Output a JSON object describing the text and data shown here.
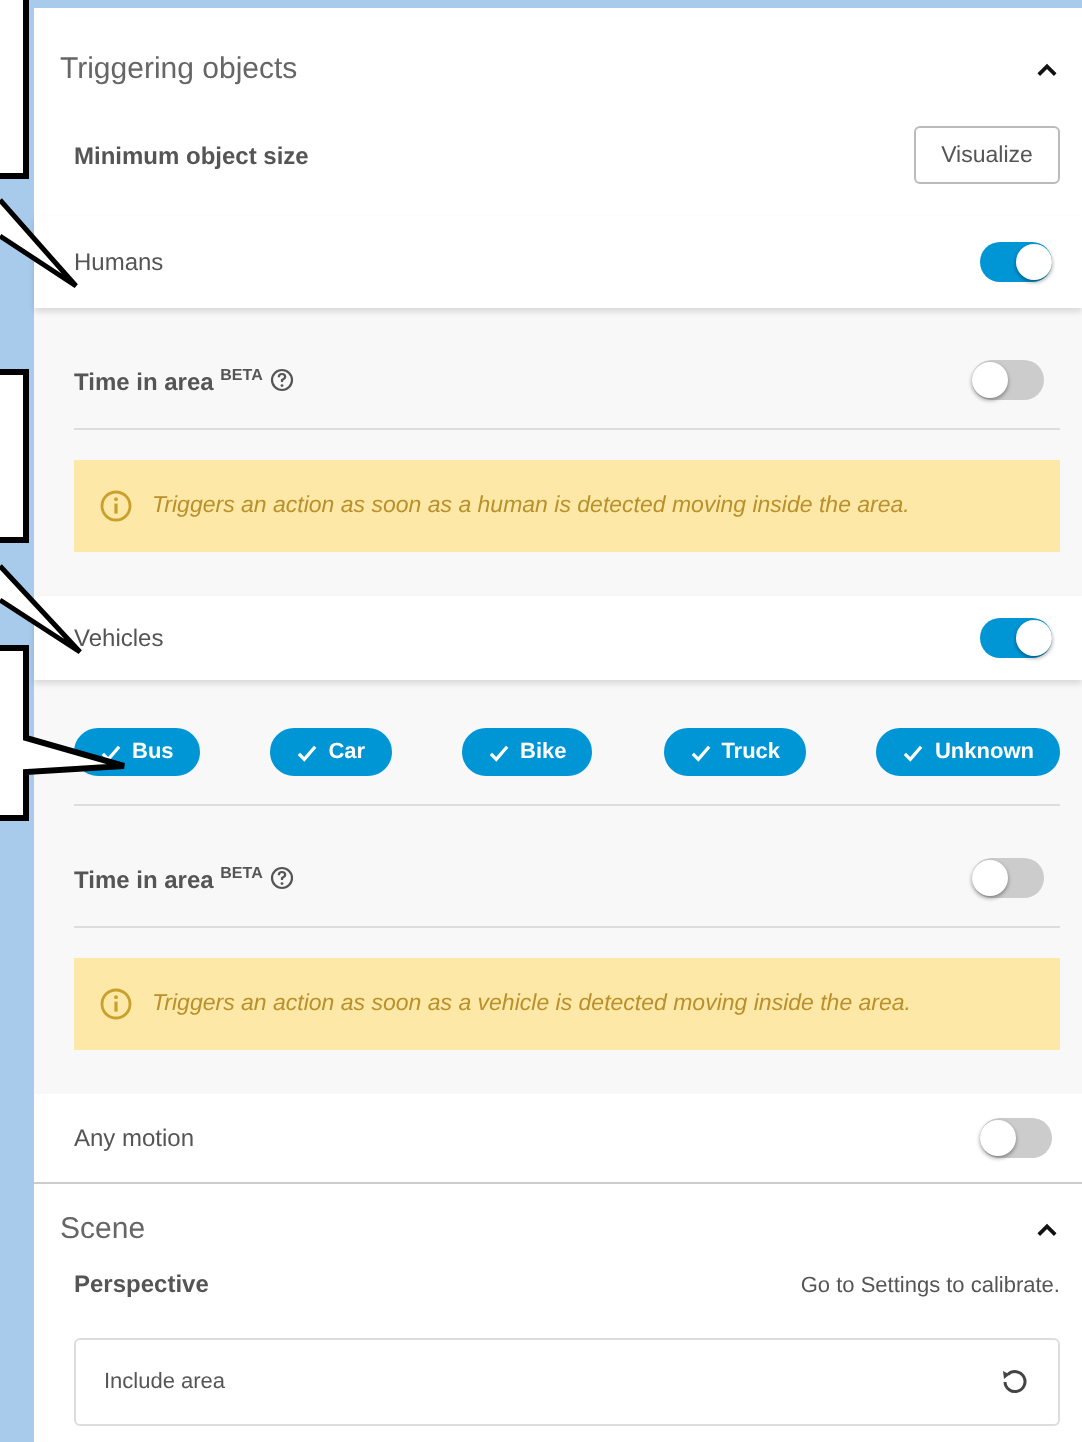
{
  "triggering": {
    "title": "Triggering objects",
    "expanded": true,
    "min_size": {
      "label": "Minimum object size",
      "button": "Visualize"
    },
    "objects": [
      {
        "label": "Humans",
        "on": true,
        "time_in_area": {
          "label": "Time in area",
          "badge": "BETA",
          "on": false
        },
        "notice": "Triggers an action as soon as a human is detected moving inside the area."
      },
      {
        "label": "Vehicles",
        "on": true,
        "types": [
          {
            "label": "Bus",
            "checked": true
          },
          {
            "label": "Car",
            "checked": true
          },
          {
            "label": "Bike",
            "checked": true
          },
          {
            "label": "Truck",
            "checked": true
          },
          {
            "label": "Unknown",
            "checked": true
          }
        ],
        "time_in_area": {
          "label": "Time in area",
          "badge": "BETA",
          "on": false
        },
        "notice": "Triggers an action as soon as a vehicle is detected moving inside the area."
      }
    ],
    "any_motion": {
      "label": "Any motion",
      "on": false
    }
  },
  "scene": {
    "title": "Scene",
    "expanded": true,
    "perspective": {
      "label": "Perspective",
      "hint": "Go to Settings to calibrate."
    },
    "include_area": {
      "label": "Include area"
    }
  }
}
